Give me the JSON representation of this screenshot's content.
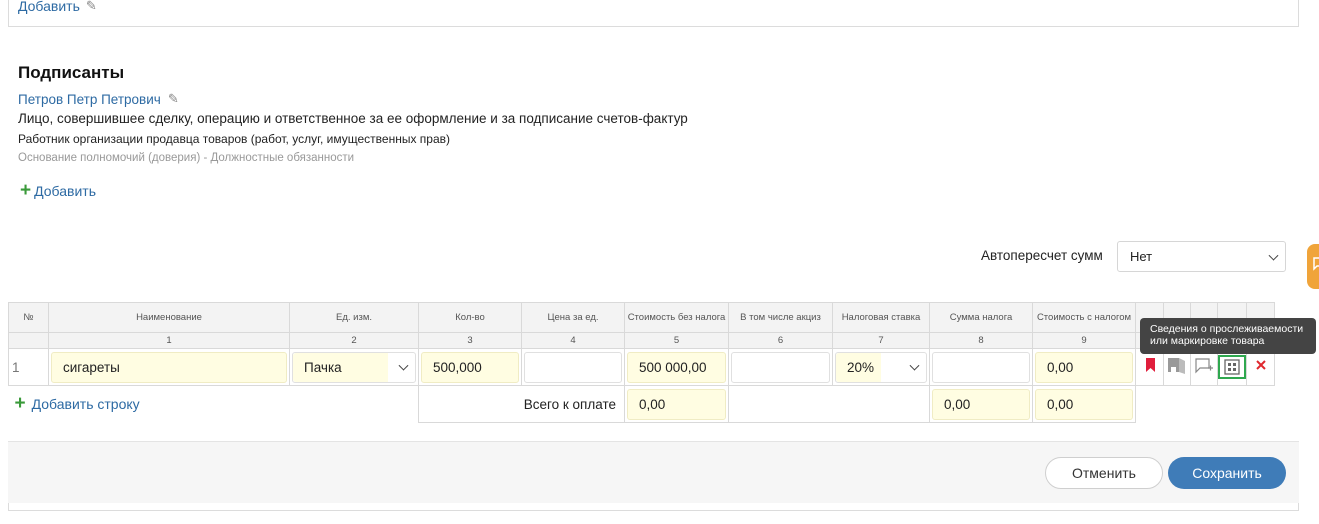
{
  "top": {
    "add_label": "Добавить"
  },
  "signers": {
    "title": "Подписанты",
    "person": "Петров Петр Петрович",
    "role": "Лицо, совершившее сделку, операцию и ответственное за ее оформление и за подписание счетов-фактур",
    "position": "Работник организации продавца товаров (работ, услуг, имущественных прав)",
    "authority": "Основание полномочий (доверия) - Должностные обязанности",
    "add_label": "Добавить"
  },
  "recalc": {
    "label": "Автопересчет сумм",
    "value": "Нет"
  },
  "table": {
    "headers": [
      "№",
      "Наименование",
      "Ед. изм.",
      "Кол-во",
      "Цена за ед.",
      "Стоимость без налога",
      "В том числе акциз",
      "Налоговая ставка",
      "Сумма налога",
      "Стоимость с налогом"
    ],
    "col_numbers": [
      "1",
      "2",
      "3",
      "4",
      "5",
      "6",
      "7",
      "8",
      "9"
    ],
    "row": {
      "num": "1",
      "name": "сигареты",
      "unit": "Пачка",
      "qty": "500,000",
      "price": "",
      "cost_no_tax": "500 000,00",
      "excise": "",
      "tax_rate": "20%",
      "tax_sum": "",
      "cost_with_tax": "0,00"
    },
    "add_row_label": "Добавить строку",
    "total_label": "Всего к оплате",
    "total_cost_no_tax": "0,00",
    "total_tax": "0,00",
    "total_with_tax": "0,00"
  },
  "tooltip": {
    "line1": "Сведения о прослеживаемости",
    "line2": "или маркировке товара"
  },
  "footer": {
    "cancel_label": "Отменить",
    "save_label": "Сохранить"
  },
  "colors": {
    "accent": "#3f7cb8",
    "highlight": "#2fa84f",
    "delete": "#e0282e",
    "bookmark": "#e01e3c"
  }
}
